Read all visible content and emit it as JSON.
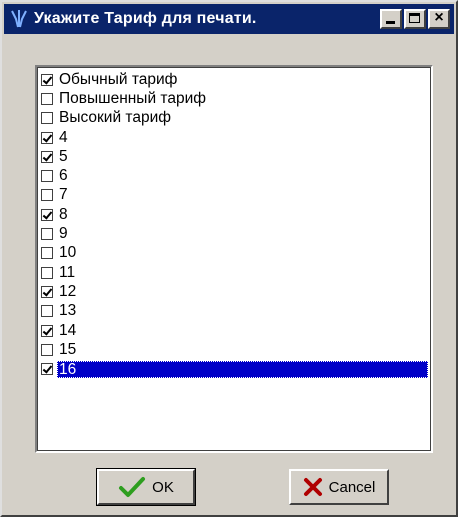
{
  "window": {
    "title": "Укажите Тариф для печати.",
    "icon": "fork-app-icon",
    "controls": [
      "minimize",
      "maximize",
      "close"
    ]
  },
  "list": {
    "items": [
      {
        "label": "Обычный тариф",
        "checked": true
      },
      {
        "label": "Повышенный тариф",
        "checked": false
      },
      {
        "label": "Высокий тариф",
        "checked": false
      },
      {
        "label": "4",
        "checked": true
      },
      {
        "label": "5",
        "checked": true
      },
      {
        "label": "6",
        "checked": false
      },
      {
        "label": "7",
        "checked": false
      },
      {
        "label": "8",
        "checked": true
      },
      {
        "label": "9",
        "checked": false
      },
      {
        "label": "10",
        "checked": false
      },
      {
        "label": "11",
        "checked": false
      },
      {
        "label": "12",
        "checked": true
      },
      {
        "label": "13",
        "checked": false
      },
      {
        "label": "14",
        "checked": true
      },
      {
        "label": "15",
        "checked": false
      },
      {
        "label": "16",
        "checked": true,
        "selected": true
      }
    ]
  },
  "buttons": {
    "ok_label": "OK",
    "cancel_label": "Cancel"
  },
  "colors": {
    "titlebar": "#0a246a",
    "selection": "#0000c8",
    "ok_check": "#2e9e1f",
    "cancel_x": "#b00000"
  }
}
